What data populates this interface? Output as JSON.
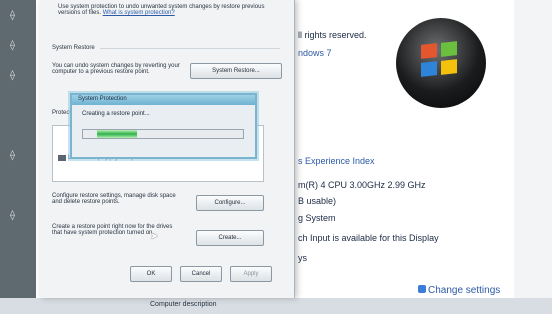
{
  "background": {
    "text_lines": [
      "ll rights reserved.",
      "ndows 7",
      "s Experience Index",
      "m(R) 4 CPU 3.00GHz   2.99 GHz",
      "B usable)",
      "g System",
      "ch Input is available for this Display",
      "ys"
    ],
    "change_settings": "Change settings",
    "computer_description": "Computer description"
  },
  "window": {
    "intro": "Use system protection to undo unwanted system changes by restore previous versions of files.",
    "intro_link": "What is system protection?",
    "system_restore_group": "System Restore",
    "restore_text": "You can undo system changes by reverting your computer to a previous restore point.",
    "system_restore_button": "System Restore...",
    "protection_group": "Protection Settings",
    "drive_label": "Local Disk (C:) (System)",
    "drive_status": "On",
    "configure_text": "Configure restore settings, manage disk space and delete restore points.",
    "configure_button": "Configure...",
    "create_text": "Create a restore point right now for the drives that have system protection turned on.",
    "create_button": "Create...",
    "ok_button": "OK",
    "cancel_button": "Cancel",
    "apply_button": "Apply"
  },
  "progress_dialog": {
    "title": "System Protection",
    "message": "Creating a restore point..."
  }
}
